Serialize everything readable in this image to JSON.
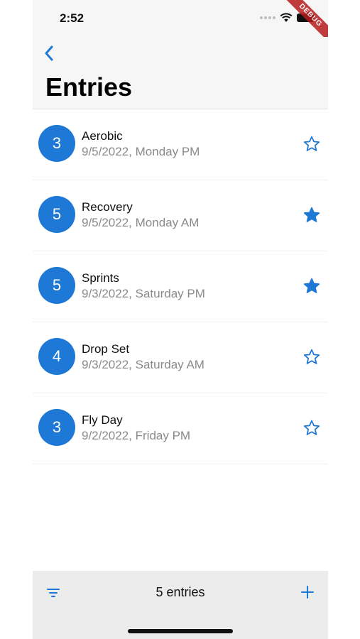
{
  "status_bar": {
    "time": "2:52",
    "debug_label": "DEBUG"
  },
  "navbar": {
    "title": "Entries"
  },
  "colors": {
    "accent": "#1e78d6",
    "avatar": "#1e78d6"
  },
  "entries": [
    {
      "number": "3",
      "title": "Aerobic",
      "subtitle": "9/5/2022, Monday PM",
      "starred": false
    },
    {
      "number": "5",
      "title": "Recovery",
      "subtitle": "9/5/2022, Monday AM",
      "starred": true
    },
    {
      "number": "5",
      "title": "Sprints",
      "subtitle": "9/3/2022, Saturday PM",
      "starred": true
    },
    {
      "number": "4",
      "title": "Drop Set",
      "subtitle": "9/3/2022, Saturday AM",
      "starred": false
    },
    {
      "number": "3",
      "title": "Fly Day",
      "subtitle": "9/2/2022, Friday PM",
      "starred": false
    }
  ],
  "bottom_bar": {
    "count_label": "5 entries",
    "left_icon": "filter-icon",
    "right_icon": "add-icon"
  }
}
